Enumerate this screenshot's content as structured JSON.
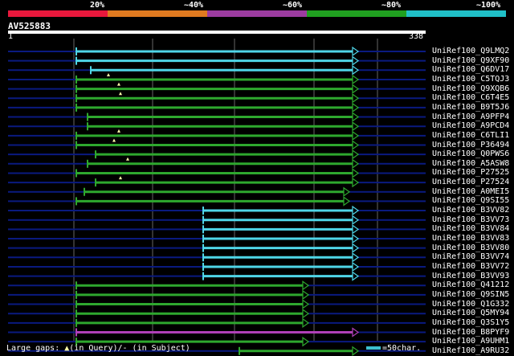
{
  "legend": {
    "labels": [
      "20%",
      "~40%",
      "~60%",
      "~80%",
      "~100%"
    ],
    "colors": [
      "#e8183c",
      "#e07a20",
      "#9c3ca0",
      "#20a020",
      "#20c0c8"
    ]
  },
  "query": {
    "id": "AV525883",
    "start": "1",
    "end": "338"
  },
  "colors": {
    "cyan": "#4fd6e8",
    "green": "#2ea82e",
    "purple": "#b040b8",
    "gap": "#0a1a80",
    "grid": "#666666"
  },
  "rows": [
    {
      "label": "UniRef100_Q9LMQ2",
      "start": 95,
      "end": 446,
      "color": "cyan",
      "marks": []
    },
    {
      "label": "UniRef100_Q9XF90",
      "start": 95,
      "end": 446,
      "color": "cyan",
      "marks": []
    },
    {
      "label": "UniRef100_Q6DV17",
      "start": 113,
      "end": 446,
      "color": "cyan",
      "marks": []
    },
    {
      "label": "UniRef100_C5TQJ3",
      "start": 95,
      "end": 446,
      "color": "green",
      "marks": [
        135
      ]
    },
    {
      "label": "UniRef100_Q9XQB6",
      "start": 95,
      "end": 446,
      "color": "green",
      "marks": [
        148
      ]
    },
    {
      "label": "UniRef100_C6T4E5",
      "start": 95,
      "end": 446,
      "color": "green",
      "marks": [
        150
      ]
    },
    {
      "label": "UniRef100_B9T5J6",
      "start": 95,
      "end": 446,
      "color": "green",
      "marks": []
    },
    {
      "label": "UniRef100_A9PFP4",
      "start": 109,
      "end": 446,
      "color": "green",
      "marks": []
    },
    {
      "label": "UniRef100_A9PCD4",
      "start": 109,
      "end": 446,
      "color": "green",
      "marks": []
    },
    {
      "label": "UniRef100_C6TLI1",
      "start": 95,
      "end": 446,
      "color": "green",
      "marks": [
        148
      ]
    },
    {
      "label": "UniRef100_P36494",
      "start": 95,
      "end": 446,
      "color": "green",
      "marks": [
        142
      ]
    },
    {
      "label": "UniRef100_Q0PWS6",
      "start": 119,
      "end": 446,
      "color": "green",
      "marks": []
    },
    {
      "label": "UniRef100_A5ASW8",
      "start": 109,
      "end": 446,
      "color": "green",
      "marks": [
        159
      ]
    },
    {
      "label": "UniRef100_P27525",
      "start": 95,
      "end": 446,
      "color": "green",
      "marks": []
    },
    {
      "label": "UniRef100_P27524",
      "start": 119,
      "end": 446,
      "color": "green",
      "marks": [
        150
      ]
    },
    {
      "label": "UniRef100_A0MEI5",
      "start": 105,
      "end": 435,
      "color": "green",
      "marks": []
    },
    {
      "label": "UniRef100_Q9SI55",
      "start": 95,
      "end": 435,
      "color": "green",
      "marks": []
    },
    {
      "label": "UniRef100_B3VV82",
      "start": 253,
      "end": 446,
      "color": "cyan",
      "marks": []
    },
    {
      "label": "UniRef100_B3VV73",
      "start": 253,
      "end": 446,
      "color": "cyan",
      "marks": []
    },
    {
      "label": "UniRef100_B3VV84",
      "start": 253,
      "end": 446,
      "color": "cyan",
      "marks": []
    },
    {
      "label": "UniRef100_B3VV83",
      "start": 253,
      "end": 446,
      "color": "cyan",
      "marks": []
    },
    {
      "label": "UniRef100_B3VV80",
      "start": 253,
      "end": 446,
      "color": "cyan",
      "marks": []
    },
    {
      "label": "UniRef100_B3VV74",
      "start": 253,
      "end": 446,
      "color": "cyan",
      "marks": []
    },
    {
      "label": "UniRef100_B3VV72",
      "start": 253,
      "end": 446,
      "color": "cyan",
      "marks": []
    },
    {
      "label": "UniRef100_B3VV93",
      "start": 253,
      "end": 446,
      "color": "cyan",
      "marks": []
    },
    {
      "label": "UniRef100_Q41212",
      "start": 95,
      "end": 384,
      "color": "green",
      "marks": []
    },
    {
      "label": "UniRef100_Q9SIN5",
      "start": 95,
      "end": 384,
      "color": "green",
      "marks": []
    },
    {
      "label": "UniRef100_Q1G332",
      "start": 95,
      "end": 384,
      "color": "green",
      "marks": []
    },
    {
      "label": "UniRef100_Q5MY94",
      "start": 95,
      "end": 384,
      "color": "green",
      "marks": []
    },
    {
      "label": "UniRef100_Q3S1Y5",
      "start": 95,
      "end": 384,
      "color": "green",
      "marks": []
    },
    {
      "label": "UniRef100_B8PYF9",
      "start": 95,
      "end": 446,
      "color": "purple",
      "marks": []
    },
    {
      "label": "UniRef100_A9UHM1",
      "start": 95,
      "end": 384,
      "color": "green",
      "marks": []
    },
    {
      "label": "UniRef100_A9RU32",
      "start": 298,
      "end": 446,
      "color": "green",
      "marks": []
    }
  ],
  "footer": {
    "prefix": "Large gaps: ",
    "tri": "▲",
    "suffix": "(in Query)/- (in Subject)"
  },
  "scale": {
    "label": "=50char."
  }
}
